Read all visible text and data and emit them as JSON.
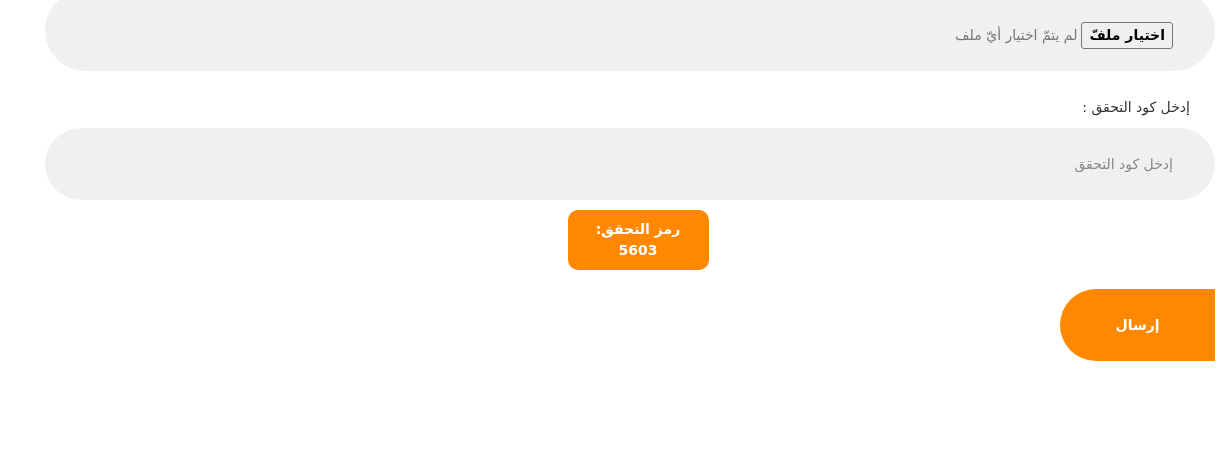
{
  "file_field": {
    "button": "اختيار ملفّ",
    "status": "لم يتمّ اختيار أيّ ملف"
  },
  "code_field": {
    "label": "إدخل كود التحقق :",
    "placeholder": "إدخل كود التحقق"
  },
  "captcha": {
    "text": "رمز التحقق: 5603"
  },
  "submit": {
    "label": "إرسال"
  }
}
